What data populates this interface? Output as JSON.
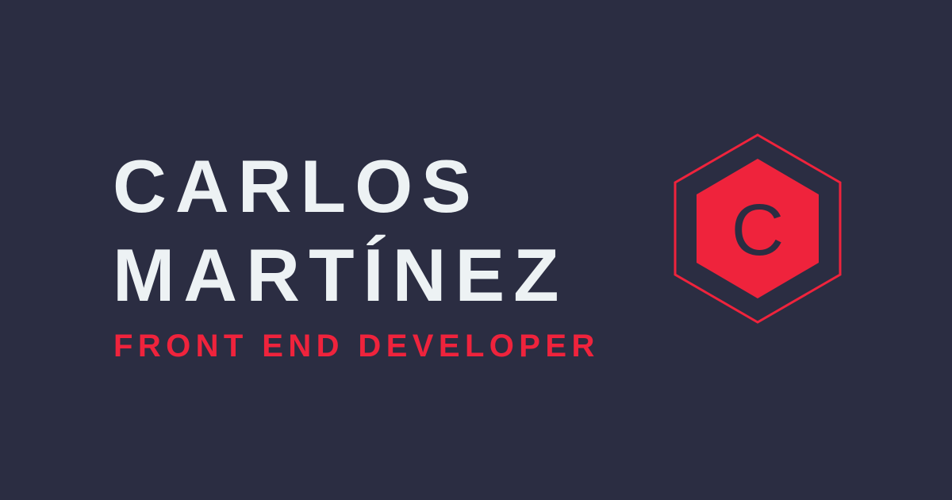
{
  "profile": {
    "first_name": "CARLOS",
    "last_name": "MARTÍNEZ",
    "role": "FRONT END DEVELOPER"
  },
  "logo": {
    "letter": "C",
    "icon": "hexagon-monogram-icon"
  },
  "colors": {
    "background": "#2b2d42",
    "text": "#edf2f4",
    "accent": "#ef233c"
  }
}
